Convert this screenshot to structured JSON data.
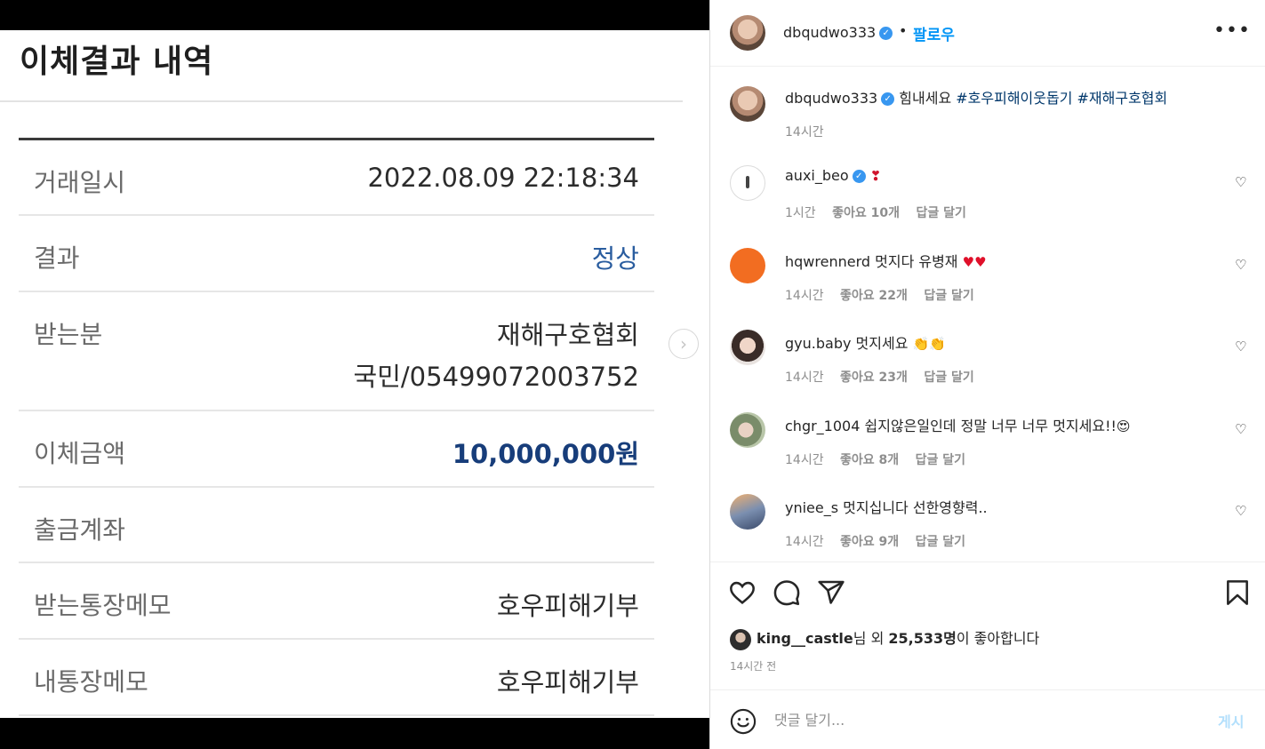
{
  "bank": {
    "title": "이체결과 내역",
    "rows": [
      {
        "label": "거래일시",
        "value": "2022.08.09 22:18:34"
      },
      {
        "label": "결과",
        "value": "정상"
      },
      {
        "label": "받는분",
        "value": "재해구호협회",
        "value2": "국민/05499072003752"
      },
      {
        "label": "이체금액",
        "value": "10,000,000원"
      },
      {
        "label": "출금계좌",
        "value": ""
      },
      {
        "label": "받는통장메모",
        "value": "호우피해기부"
      },
      {
        "label": "내통장메모",
        "value": "호우피해기부"
      }
    ],
    "next_icon": "chevron-right-icon"
  },
  "post": {
    "username": "dbqudwo333",
    "dot": "•",
    "follow": "팔로우",
    "more": "•••",
    "caption": {
      "username": "dbqudwo333",
      "text": "힘내세요",
      "hashtags": "#호우피해이웃돕기 #재해구호협회",
      "time": "14시간"
    },
    "comments": [
      {
        "username": "auxi_beo",
        "verified": true,
        "text": "",
        "emoji": "❣",
        "time": "1시간",
        "likes": "좋아요 10개",
        "reply": "답글 달기"
      },
      {
        "username": "hqwrennerd",
        "verified": false,
        "text": "멋지다 유병재",
        "emoji": "♥♥",
        "time": "14시간",
        "likes": "좋아요 22개",
        "reply": "답글 달기"
      },
      {
        "username": "gyu.baby",
        "verified": false,
        "text": "멋지세요",
        "emoji": "👏👏",
        "time": "14시간",
        "likes": "좋아요 23개",
        "reply": "답글 달기"
      },
      {
        "username": "chgr_1004",
        "verified": false,
        "text": "쉽지않은일인데 정말 너무 너무 멋지세요!!",
        "emoji": "😍",
        "time": "14시간",
        "likes": "좋아요 8개",
        "reply": "답글 달기"
      },
      {
        "username": "yniee_s",
        "verified": false,
        "text": "멋지십니다 선한영향력..",
        "emoji": "",
        "time": "14시간",
        "likes": "좋아요 9개",
        "reply": "답글 달기"
      }
    ],
    "likes_summary": {
      "user": "king__castle",
      "mid": "님 외 ",
      "count": "25,533명",
      "tail": "이 좋아합니다"
    },
    "time_ago": "14시간 전",
    "comment_placeholder": "댓글 달기...",
    "post_button": "게시"
  },
  "colors": {
    "link": "#00376b",
    "accent": "#0095f6",
    "verified": "#3897f0",
    "bank_blue": "#2a5d9f"
  }
}
